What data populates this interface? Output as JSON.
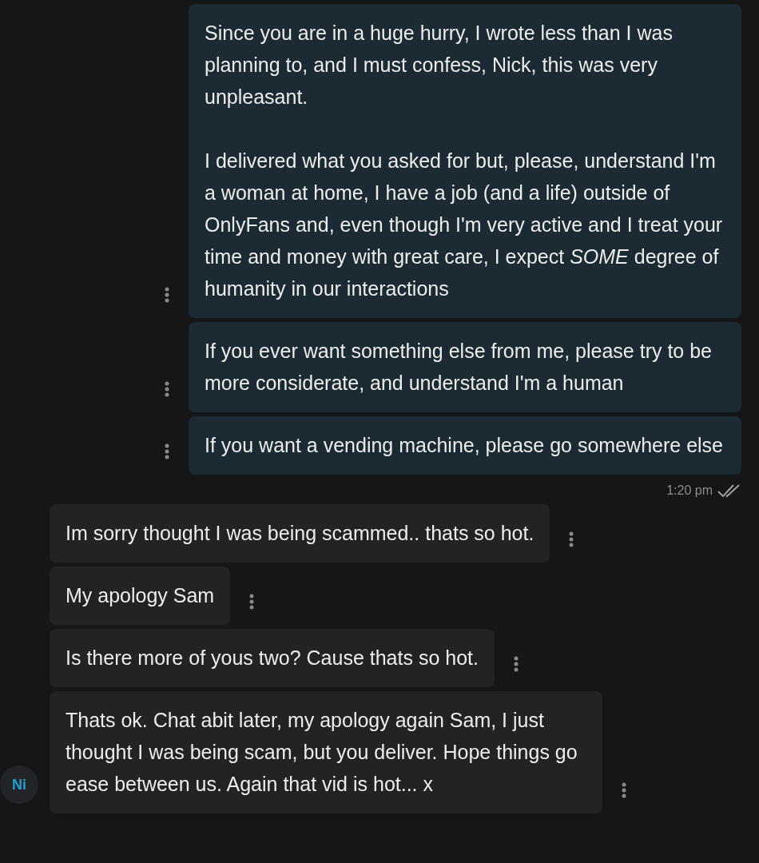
{
  "messages": [
    {
      "kind": "outgoing",
      "paragraphs": [
        "Since you are in a huge hurry, I wrote less than I was planning to, and I must confess, Nick, this was very unpleasant.",
        "I delivered what you asked for but, please, understand I'm a woman at home, I have a job (and a life) outside of OnlyFans and, even though I'm very active and I treat your time and money with great care, I expect *SOME* degree of humanity in our interactions"
      ]
    },
    {
      "kind": "outgoing",
      "paragraphs": [
        "If you ever want something else from me, please try to be more considerate, and understand I'm a human"
      ]
    },
    {
      "kind": "outgoing",
      "paragraphs": [
        "If you want a vending machine, please go somewhere else"
      ],
      "time": "1:20 pm",
      "read": true
    },
    {
      "kind": "incoming",
      "paragraphs": [
        "Im sorry thought I was being scammed.. thats so hot."
      ]
    },
    {
      "kind": "incoming",
      "paragraphs": [
        "My apology Sam"
      ]
    },
    {
      "kind": "incoming",
      "paragraphs": [
        "Is there more of yous two? Cause thats so hot."
      ]
    },
    {
      "kind": "incoming",
      "paragraphs": [
        "Thats ok. Chat abit later, my apology again Sam, I just thought I was being scam, but you deliver. Hope things go ease between us. Again that vid is hot... x"
      ],
      "avatar": {
        "initials": "Ni"
      }
    }
  ]
}
